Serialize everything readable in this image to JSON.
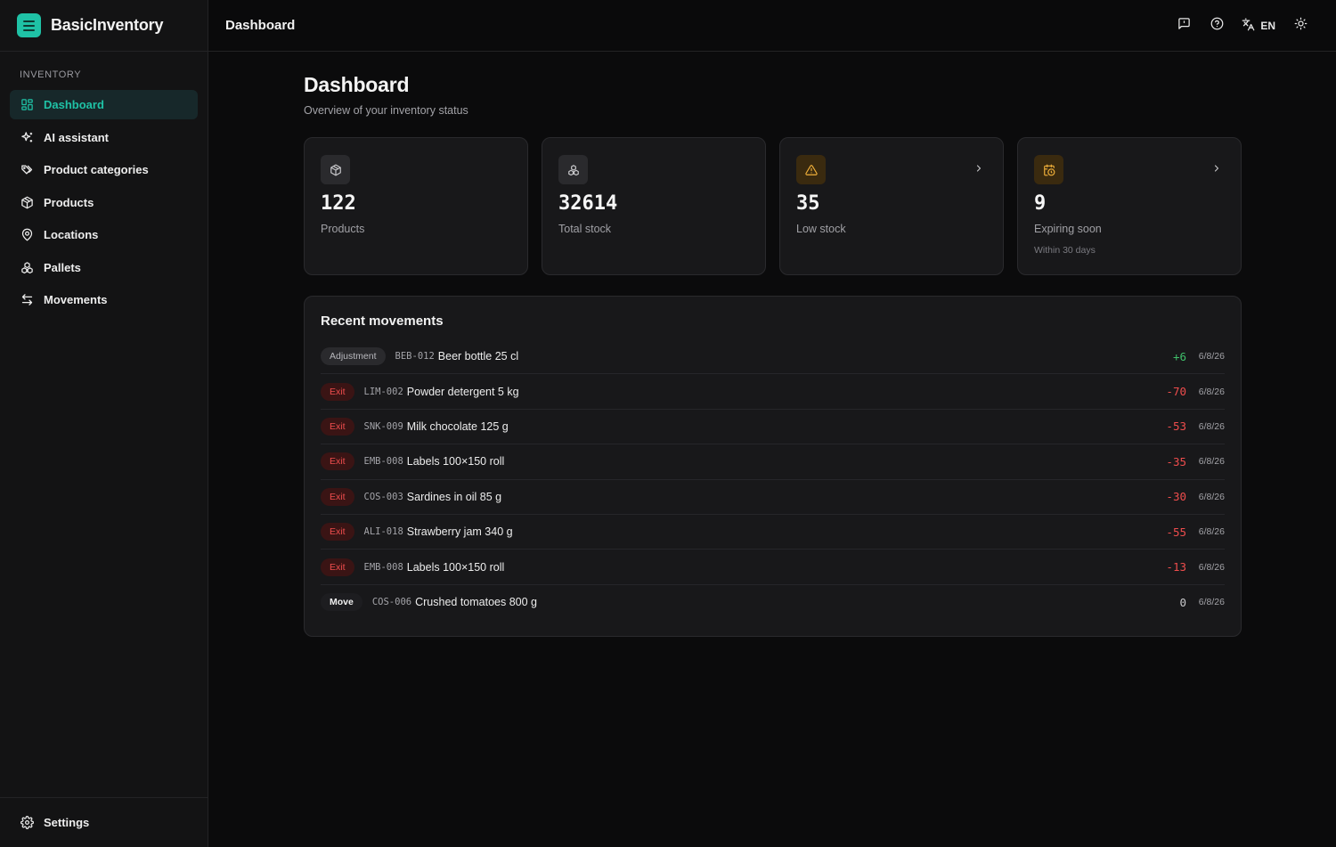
{
  "app": {
    "name": "BasicInventory"
  },
  "colors": {
    "accent": "#1fc2a6",
    "positive": "#3fbf6a",
    "negative": "#ef4d4d",
    "warning": "#f1b03a"
  },
  "sidebar": {
    "section_heading": "INVENTORY",
    "items": [
      {
        "label": "Dashboard",
        "icon": "layout-grid-icon",
        "active": true
      },
      {
        "label": "AI assistant",
        "icon": "sparkles-icon"
      },
      {
        "label": "Product categories",
        "icon": "tags-icon"
      },
      {
        "label": "Products",
        "icon": "package-icon"
      },
      {
        "label": "Locations",
        "icon": "map-pin-icon"
      },
      {
        "label": "Pallets",
        "icon": "boxes-icon"
      },
      {
        "label": "Movements",
        "icon": "arrows-left-right-icon"
      }
    ],
    "footer": {
      "label": "Settings",
      "icon": "gear-icon"
    }
  },
  "topbar": {
    "title": "Dashboard",
    "language": "EN"
  },
  "page": {
    "title": "Dashboard",
    "subtitle": "Overview of your inventory status"
  },
  "stats": [
    {
      "value": "122",
      "label": "Products",
      "icon": "package-icon"
    },
    {
      "value": "32614",
      "label": "Total stock",
      "icon": "boxes-icon"
    },
    {
      "value": "35",
      "label": "Low stock",
      "icon": "alert-triangle-icon"
    },
    {
      "value": "9",
      "label": "Expiring soon",
      "sublabel": "Within 30 days",
      "icon": "calendar-clock-icon"
    }
  ],
  "recent": {
    "title": "Recent movements",
    "rows": [
      {
        "type": "Adjustment",
        "sku": "BEB-012",
        "name": "Beer bottle 25 cl",
        "qty": "+6",
        "date": "6/8/26"
      },
      {
        "type": "Exit",
        "sku": "LIM-002",
        "name": "Powder detergent 5 kg",
        "qty": "-70",
        "date": "6/8/26"
      },
      {
        "type": "Exit",
        "sku": "SNK-009",
        "name": "Milk chocolate 125 g",
        "qty": "-53",
        "date": "6/8/26"
      },
      {
        "type": "Exit",
        "sku": "EMB-008",
        "name": "Labels 100×150 roll",
        "qty": "-35",
        "date": "6/8/26"
      },
      {
        "type": "Exit",
        "sku": "COS-003",
        "name": "Sardines in oil 85 g",
        "qty": "-30",
        "date": "6/8/26"
      },
      {
        "type": "Exit",
        "sku": "ALI-018",
        "name": "Strawberry jam 340 g",
        "qty": "-55",
        "date": "6/8/26"
      },
      {
        "type": "Exit",
        "sku": "EMB-008",
        "name": "Labels 100×150 roll",
        "qty": "-13",
        "date": "6/8/26"
      },
      {
        "type": "Move",
        "sku": "COS-006",
        "name": "Crushed tomatoes 800 g",
        "qty": "0",
        "date": "6/8/26"
      }
    ]
  }
}
